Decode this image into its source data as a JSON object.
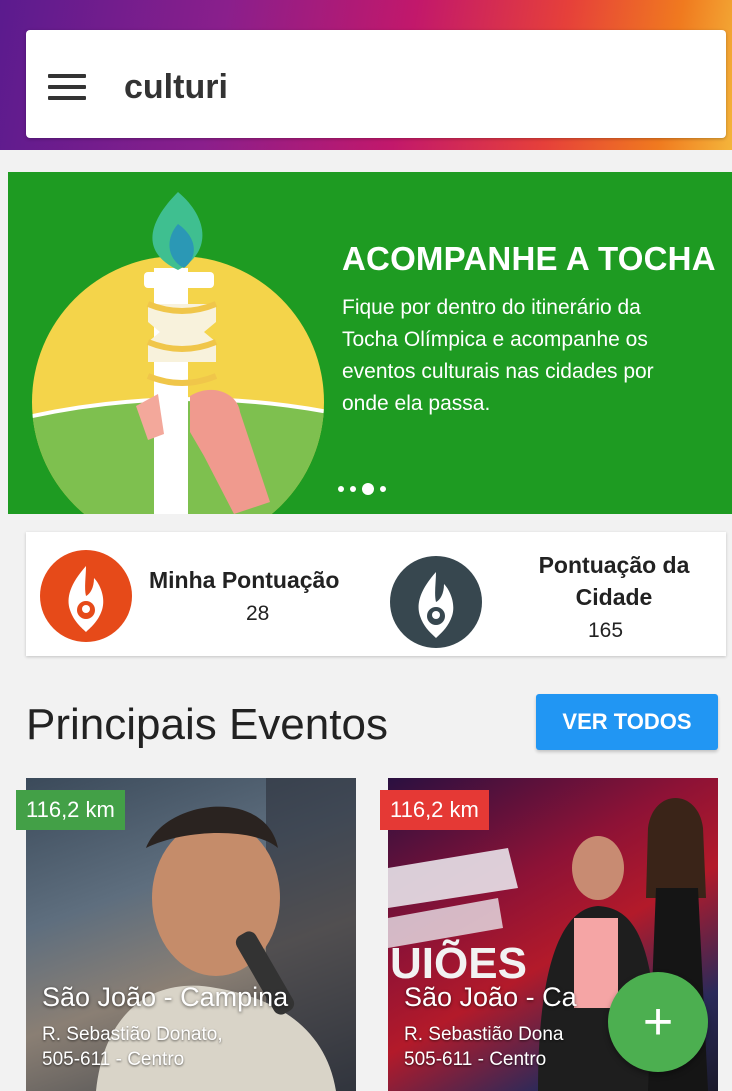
{
  "app": {
    "title": "culturi"
  },
  "banner": {
    "title": "ACOMPANHE A TOCHA",
    "text": "Fique por dentro do itinerário da Tocha Olímpica e acompanhe os eventos culturais nas cidades por onde ela passa.",
    "slides_count": 4,
    "active_slide": 3,
    "colors": {
      "background": "#1e9b22"
    }
  },
  "score": {
    "mine": {
      "label": "Minha Pontuação",
      "value": "28",
      "icon": "flame-pin-icon",
      "color": "#e64a19"
    },
    "city": {
      "label": "Pontuação da Cidade",
      "value": "165",
      "icon": "flame-pin-icon",
      "color": "#37474f"
    }
  },
  "section": {
    "title": "Principais Eventos",
    "see_all": "VER TODOS"
  },
  "events": [
    {
      "distance": "116,2 km",
      "title": "São João - Campina",
      "address_line1": "R. Sebastião Donato,",
      "address_line2": "505-611 - Centro",
      "badge_color": "#43a047"
    },
    {
      "distance": "116,2 km",
      "title": "São João - Ca",
      "address_line1": "R. Sebastião Dona",
      "address_line2": "505-611 - Centro",
      "badge_color": "#e53935"
    }
  ],
  "fab": {
    "label": "+",
    "icon": "plus-icon"
  }
}
